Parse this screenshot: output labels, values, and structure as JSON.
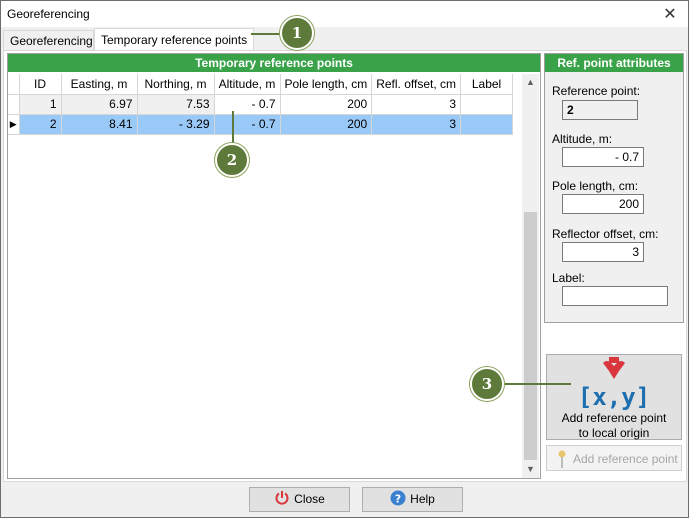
{
  "window": {
    "title": "Georeferencing",
    "close_glyph": "✕"
  },
  "tabs": [
    {
      "label": "Georeferencing",
      "active": false
    },
    {
      "label": "Temporary reference points",
      "active": true
    }
  ],
  "grid": {
    "title": "Temporary reference points",
    "columns": [
      "ID",
      "Easting, m",
      "Northing, m",
      "Altitude, m",
      "Pole length, cm",
      "Refl. offset, cm",
      "Label"
    ],
    "rows": [
      {
        "indicator": "",
        "cells": [
          "1",
          "6.97",
          "7.53",
          "- 0.7",
          "200",
          "3",
          ""
        ]
      },
      {
        "indicator": "▶",
        "cells": [
          "2",
          "8.41",
          "-  3.29",
          "- 0.7",
          "200",
          "3",
          ""
        ]
      }
    ]
  },
  "attributes": {
    "title": "Ref. point attributes",
    "reference_point_label": "Reference point:",
    "reference_point_value": "2",
    "altitude_label": "Altitude, m:",
    "altitude_value": "- 0.7",
    "pole_length_label": "Pole length, cm:",
    "pole_length_value": "200",
    "reflector_offset_label": "Reflector offset, cm:",
    "reflector_offset_value": "3",
    "label_label": "Label:",
    "label_value": ""
  },
  "add_origin_button": {
    "line1": "Add reference point",
    "line2": "to local origin",
    "icon_text": "[x,y]"
  },
  "add_point_button": {
    "label": "Add reference point"
  },
  "bottom_buttons": {
    "close": "Close",
    "help": "Help"
  },
  "callouts": [
    "1",
    "2",
    "3"
  ],
  "colors": {
    "header_green": "#3aa34a",
    "selection": "#99c9f7",
    "callout": "#5e7a3a",
    "icon_blue": "#1e6fb0",
    "icon_red": "#d9363e"
  }
}
